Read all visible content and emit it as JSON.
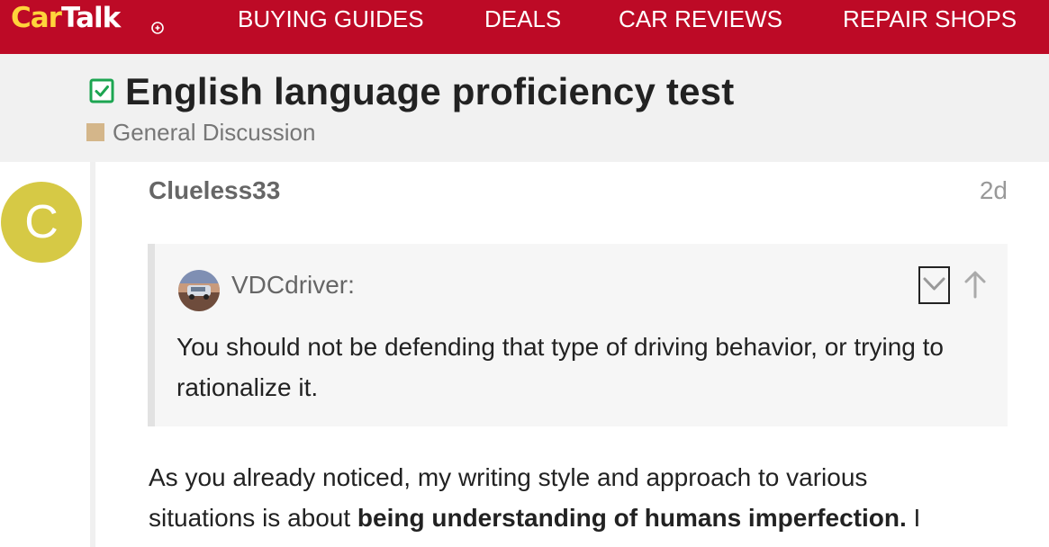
{
  "header": {
    "logo_car": "Car",
    "logo_talk": "Talk",
    "nav": [
      "BUYING GUIDES",
      "DEALS",
      "CAR REVIEWS",
      "REPAIR SHOPS"
    ]
  },
  "topic": {
    "title": "English language proficiency test",
    "category": "General Discussion",
    "category_color": "#d4b68a",
    "status_icon": "solved-checkbox-icon"
  },
  "post": {
    "avatar_letter": "C",
    "avatar_color": "#d6c945",
    "username": "Clueless33",
    "date": "2d",
    "quote": {
      "author": "VDCdriver:",
      "text": "You should not be defending that type of driving behavior, or trying to rationalize it."
    },
    "body": {
      "line1": "As you already noticed, my writing style and approach to various",
      "line2_pre": "situations is about ",
      "line2_bold": "being understanding of humans imperfection.",
      "line2_post": " I"
    }
  },
  "colors": {
    "brand_red": "#bd0a26",
    "logo_yellow": "#ffd43b",
    "solved_green": "#1ca551"
  }
}
